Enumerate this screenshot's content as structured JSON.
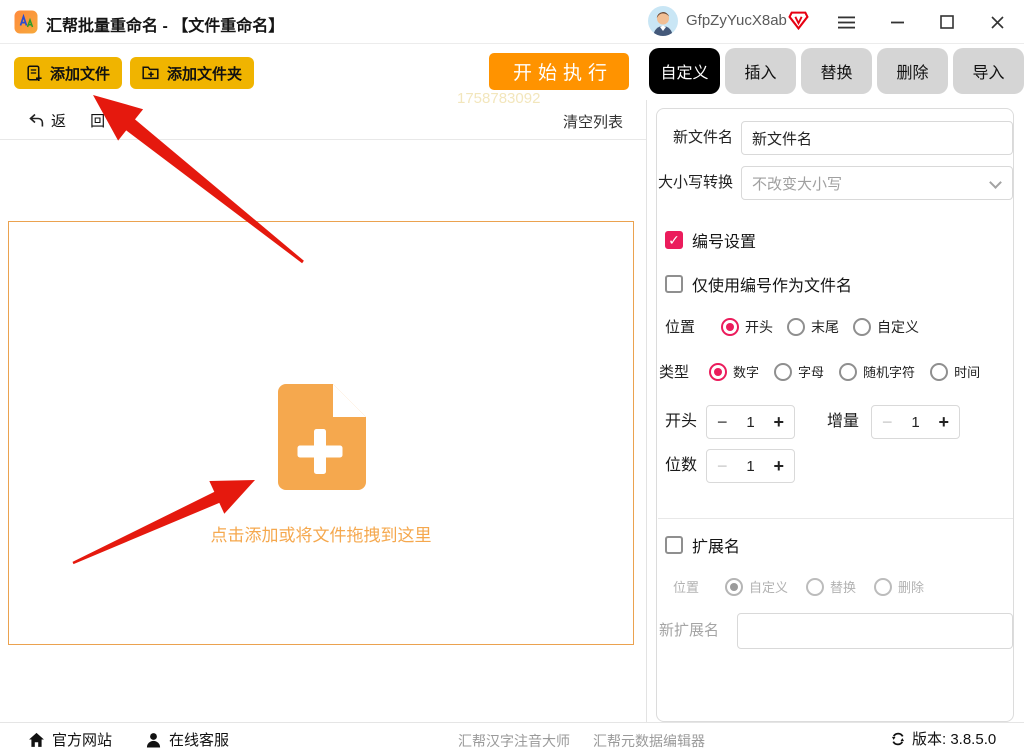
{
  "colors": {
    "gold": "#f0b400",
    "orange": "#ff9300",
    "accent_red": "#eb1c5c",
    "arrow_red": "#e5190e",
    "drop_orange": "#f5a84e",
    "tab_active_bg": "#000000",
    "tab_inactive_bg": "#d5d5d5"
  },
  "titlebar": {
    "title": "汇帮批量重命名 - 【文件重命名】",
    "username": "GfpZyYucX8ab"
  },
  "toolbar": {
    "add_file": "添加文件",
    "add_folder": "添加文件夹",
    "execute": "开始执行",
    "watermark": "1758783092"
  },
  "tabs": [
    {
      "label": "自定义",
      "active": true
    },
    {
      "label": "插入",
      "active": false
    },
    {
      "label": "替换",
      "active": false
    },
    {
      "label": "删除",
      "active": false
    },
    {
      "label": "导入",
      "active": false
    }
  ],
  "file_list": {
    "back": "返 回",
    "clear": "清空列表",
    "drop_hint": "点击添加或将文件拖拽到这里"
  },
  "form": {
    "new_name_label": "新文件名",
    "new_name_value": "新文件名",
    "case_label": "大小写转换",
    "case_value": "不改变大小写",
    "numbering": {
      "title": "编号设置",
      "only_number": "仅使用编号作为文件名",
      "position_label": "位置",
      "position_options": [
        "开头",
        "末尾",
        "自定义"
      ],
      "position_selected": "开头",
      "type_label": "类型",
      "type_options": [
        "数字",
        "字母",
        "随机字符",
        "时间"
      ],
      "type_selected": "数字",
      "start_label": "开头",
      "start_value": "1",
      "increment_label": "增量",
      "increment_value": "1",
      "digits_label": "位数",
      "digits_value": "1"
    },
    "extension": {
      "title": "扩展名",
      "position_label": "位置",
      "position_options": [
        "自定义",
        "替换",
        "删除"
      ],
      "position_selected": "自定义",
      "new_ext_label": "新扩展名",
      "new_ext_value": ""
    }
  },
  "footer": {
    "official_site": "官方网站",
    "online_service": "在线客服",
    "link1": "汇帮汉字注音大师",
    "link2": "汇帮元数据编辑器",
    "version": "版本: 3.8.5.0"
  },
  "icons": {
    "minus": "−",
    "plus": "+",
    "check": "✓"
  }
}
